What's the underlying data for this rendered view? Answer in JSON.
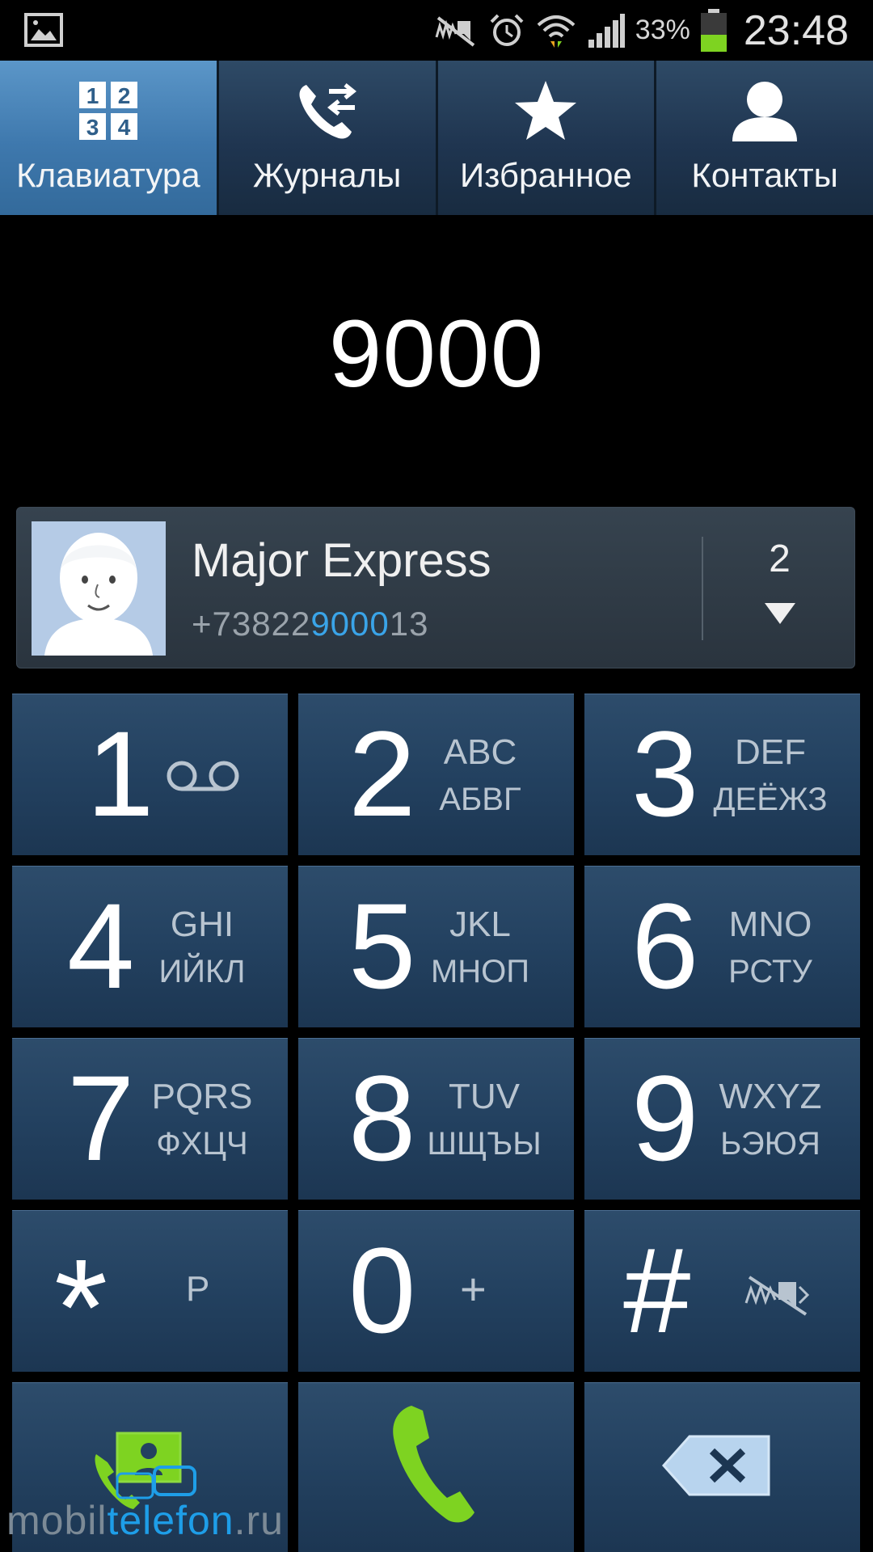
{
  "status_bar": {
    "left_icon": "gallery-notification-icon",
    "icons": [
      "mute-icon",
      "alarm-icon",
      "wifi-icon",
      "signal-icon"
    ],
    "battery_percent": "33%",
    "time": "23:48"
  },
  "tabs": [
    {
      "label": "Клавиатура",
      "icon": "keypad-icon",
      "active": true
    },
    {
      "label": "Журналы",
      "icon": "call-log-icon",
      "active": false
    },
    {
      "label": "Избранное",
      "icon": "star-icon",
      "active": false
    },
    {
      "label": "Контакты",
      "icon": "contact-icon",
      "active": false
    }
  ],
  "dialed_number": "9000",
  "suggestion": {
    "name": "Major Express",
    "phone_prefix": "+73822",
    "phone_match": "9000",
    "phone_suffix": "13",
    "count": "2"
  },
  "keypad": [
    {
      "digit": "1",
      "letters1": "",
      "letters2": "",
      "sub": "voicemail-icon"
    },
    {
      "digit": "2",
      "letters1": "ABC",
      "letters2": "АБВГ"
    },
    {
      "digit": "3",
      "letters1": "DEF",
      "letters2": "ДЕЁЖЗ"
    },
    {
      "digit": "4",
      "letters1": "GHI",
      "letters2": "ИЙКЛ"
    },
    {
      "digit": "5",
      "letters1": "JKL",
      "letters2": "МНОП"
    },
    {
      "digit": "6",
      "letters1": "MNO",
      "letters2": "РСТУ"
    },
    {
      "digit": "7",
      "letters1": "PQRS",
      "letters2": "ФХЦЧ"
    },
    {
      "digit": "8",
      "letters1": "TUV",
      "letters2": "ШЩЪЫ"
    },
    {
      "digit": "9",
      "letters1": "WXYZ",
      "letters2": "ЬЭЮЯ"
    },
    {
      "digit": "*",
      "sub": "P"
    },
    {
      "digit": "0",
      "sub": "+"
    },
    {
      "digit": "#",
      "sub": "mute-icon"
    }
  ],
  "actions": [
    "add-contact-icon",
    "call-icon",
    "backspace-icon"
  ],
  "watermark": {
    "part1": "mobil",
    "part2": "telefon",
    "part3": ".ru"
  },
  "colors": {
    "accent": "#3aa4e8",
    "call_green": "#7ed321",
    "active_tab": "#3e78ad"
  }
}
